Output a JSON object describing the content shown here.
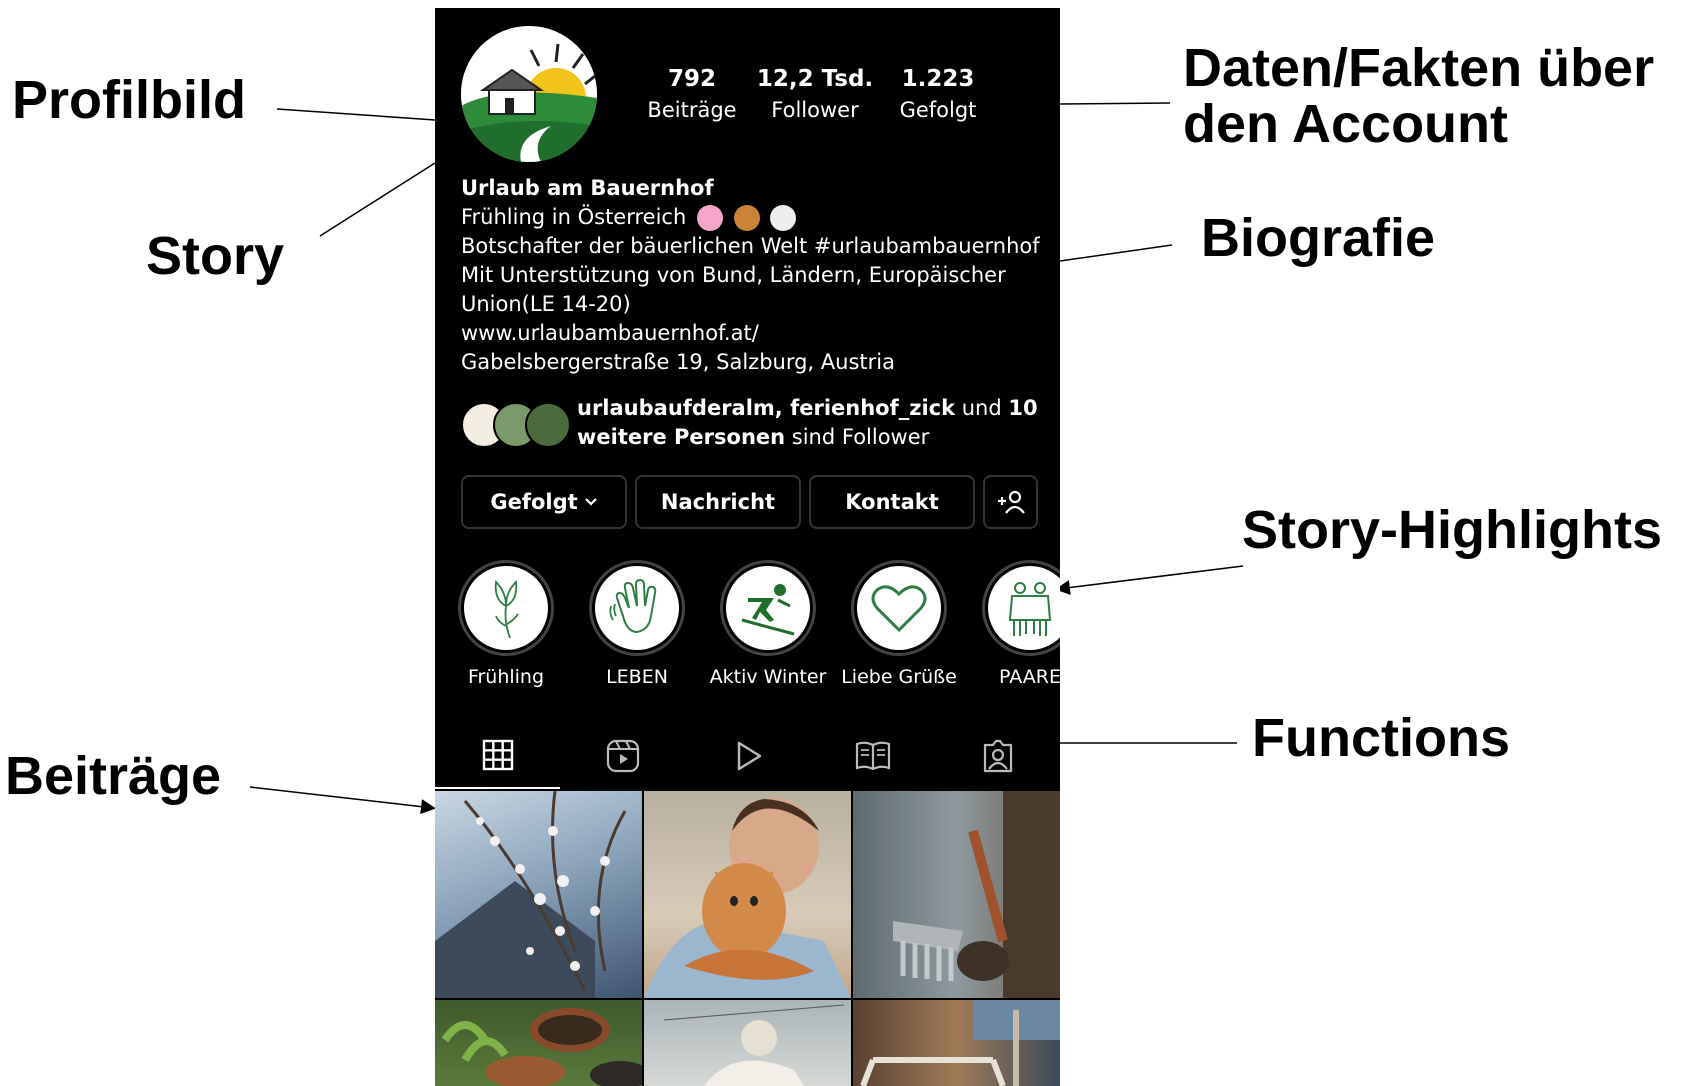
{
  "annotations": {
    "profilbild": "Profilbild",
    "story": "Story",
    "beitraege": "Beiträge",
    "daten_line1": "Daten/Fakten über",
    "daten_line2": "den Account",
    "biografie": "Biografie",
    "story_highlights": "Story-Highlights",
    "functions": "Functions"
  },
  "profile": {
    "stats": [
      {
        "value": "792",
        "label": "Beiträge"
      },
      {
        "value": "12,2 Tsd.",
        "label": "Follower"
      },
      {
        "value": "1.223",
        "label": "Gefolgt"
      }
    ],
    "name": "Urlaub am Bauernhof",
    "bio_line1": "Frühling in Österreich",
    "bio_line2": "Botschafter der bäuerlichen Welt #urlaubambauernhof",
    "bio_line3": "Mit Unterstützung von Bund, Ländern, Europäischer",
    "bio_line4": "Union(LE 14-20)",
    "website": "www.urlaubambauernhof.at/",
    "address": "Gabelsbergerstraße 19, Salzburg, Austria",
    "emojis": [
      "cherry-blossom-icon",
      "farmer-icon",
      "cow-icon"
    ]
  },
  "followed_by": {
    "names": "urlaubaufderalm, ferienhof_zick",
    "und": " und ",
    "count": "10",
    "rest_bold": "weitere Personen",
    "suffix": " sind Follower"
  },
  "buttons": {
    "following": "Gefolgt",
    "message": "Nachricht",
    "contact": "Kontakt"
  },
  "highlights": [
    {
      "label": "Frühling",
      "icon": "tulip-icon"
    },
    {
      "label": "LEBEN",
      "icon": "waving-hand-icon"
    },
    {
      "label": "Aktiv Winter",
      "icon": "skier-icon"
    },
    {
      "label": "Liebe Grüße",
      "icon": "heart-icon"
    },
    {
      "label": "PAARE",
      "icon": "couple-icon"
    }
  ],
  "tabs": [
    "grid-icon",
    "reels-icon",
    "video-icon",
    "guides-icon",
    "tagged-icon"
  ],
  "colors": {
    "background": "#000000",
    "highlight_green": "#2e7d45",
    "text": "#ffffff"
  }
}
